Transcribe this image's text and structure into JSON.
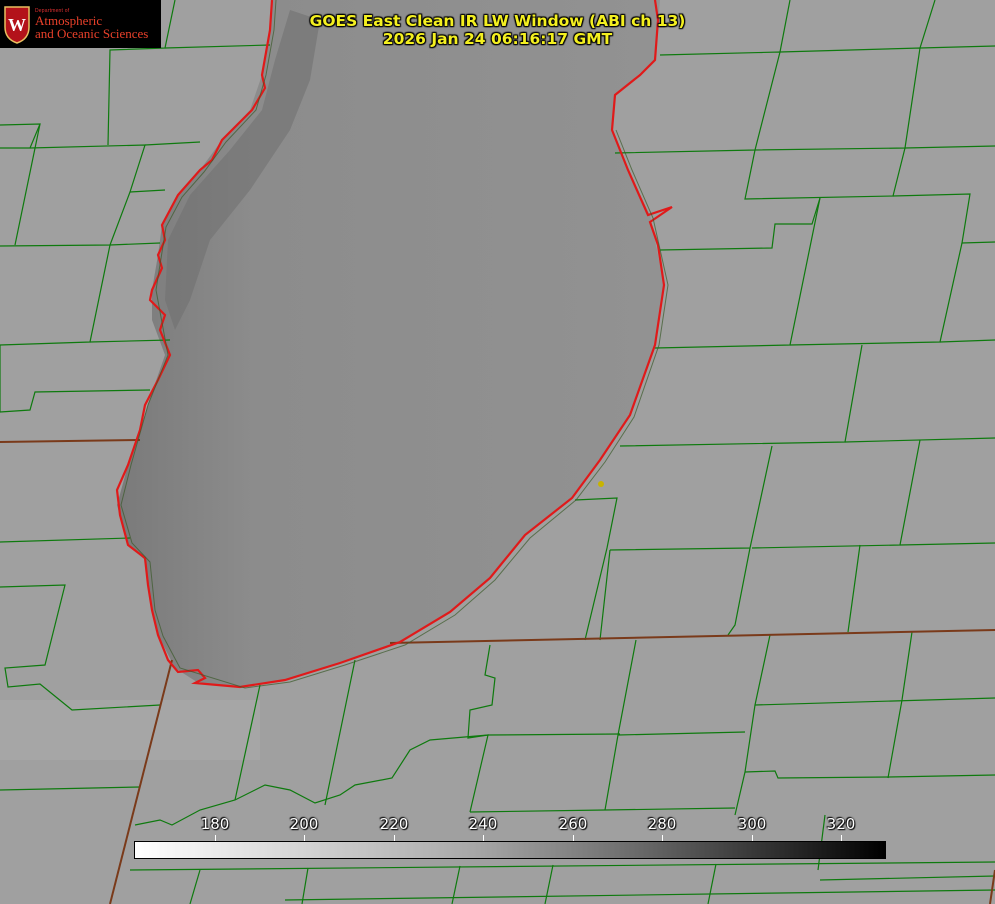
{
  "title": {
    "line1": "GOES East Clean IR LW Window (ABI ch 13)",
    "line2": "2026 Jan 24 06:16:17 GMT"
  },
  "logo": {
    "dept": "Department of",
    "line1": "Atmospheric",
    "line2": "and Oceanic Sciences",
    "seal_letter": "W"
  },
  "colorbar": {
    "ticks": [
      "180",
      "200",
      "220",
      "240",
      "260",
      "280",
      "300",
      "320"
    ],
    "gradient_start": "#ffffff",
    "gradient_end": "#000000"
  },
  "colors": {
    "background": "#9c9c9c",
    "lake": "#8f8f8f",
    "county_lines": "#0e7a0e",
    "coastline": "#e01a1a",
    "state_border": "#7a3a1a",
    "title_text": "#f4f020",
    "station_marker": "#c8b400"
  }
}
